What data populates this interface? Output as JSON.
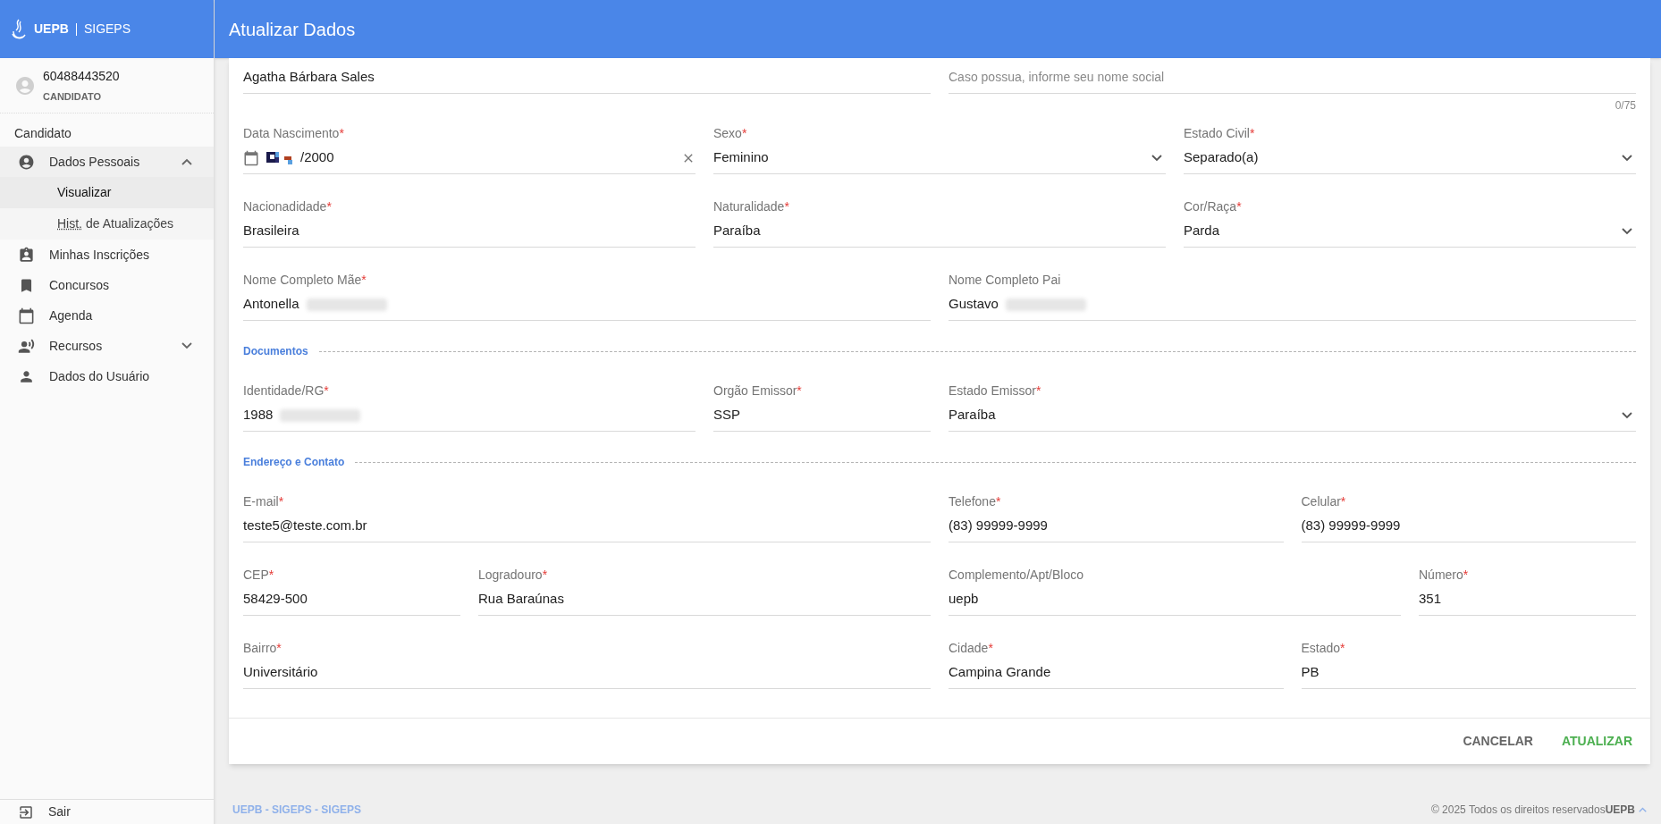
{
  "sidebar": {
    "brand": {
      "name": "UEPB",
      "suffix": "SIGEPS"
    },
    "user": {
      "id": "60488443520",
      "role": "CANDIDATO"
    },
    "section": "Candidato",
    "items": [
      {
        "label": "Dados Pessoais",
        "selected": false,
        "expanded": true,
        "children": [
          {
            "label": "Visualizar",
            "selected": true
          },
          {
            "abbr": "Hist.",
            "label": "de Atualizações",
            "selected": false
          }
        ]
      },
      {
        "label": "Minhas Inscrições",
        "selected": false
      },
      {
        "label": "Concursos",
        "selected": false
      },
      {
        "label": "Agenda",
        "selected": false
      },
      {
        "label": "Recursos",
        "selected": false,
        "expanded": false
      },
      {
        "label": "Dados do Usuário",
        "selected": false
      }
    ],
    "logout": "Sair"
  },
  "header": {
    "title": "Atualizar Dados"
  },
  "form": {
    "blocks": [
      {
        "kind": "fields",
        "fields": [
          {
            "kind": "text",
            "value": "Agatha Bárbara Sales"
          },
          {
            "kind": "text",
            "placeholder": "Caso possua, informe seu nome social",
            "counter": "0/75"
          }
        ]
      },
      {
        "kind": "fields",
        "fields": [
          {
            "kind": "date",
            "label": "Data Nascimento",
            "required_mark": "*",
            "value": "/2000",
            "pixelated": true
          },
          {
            "kind": "select",
            "label": "Sexo",
            "required_mark": "*",
            "value": "Feminino"
          },
          {
            "kind": "select",
            "label": "Estado Civil",
            "required_mark": "*",
            "value": "Separado(a)"
          }
        ]
      },
      {
        "kind": "fields",
        "fields": [
          {
            "kind": "text",
            "label": "Nacionadidade",
            "required_mark": "*",
            "value": "Brasileira"
          },
          {
            "kind": "text",
            "label": "Naturalidade",
            "required_mark": "*",
            "value": "Paraíba"
          },
          {
            "kind": "select",
            "label": "Cor/Raça",
            "required_mark": "*",
            "value": "Parda"
          }
        ]
      },
      {
        "kind": "fields",
        "fields": [
          {
            "kind": "text",
            "label": "Nome Completo Mãe",
            "required_mark": "*",
            "value": "Antonella",
            "blurred": true
          },
          {
            "kind": "text",
            "label": "Nome Completo Pai",
            "value": "Gustavo",
            "blurred": true
          }
        ]
      },
      {
        "kind": "section",
        "title": "Documentos"
      },
      {
        "kind": "fields",
        "fields": [
          {
            "kind": "text",
            "label": "Identidade/RG",
            "required_mark": "*",
            "value": "1988",
            "blurred": true
          },
          {
            "kind": "text",
            "label": "Orgão Emissor",
            "required_mark": "*",
            "value": "SSP"
          },
          {
            "kind": "select",
            "label": "Estado Emissor",
            "required_mark": "*",
            "value": "Paraíba"
          }
        ]
      },
      {
        "kind": "section",
        "title": "Endereço e Contato"
      },
      {
        "kind": "fields",
        "fields": [
          {
            "kind": "text",
            "label": "E-mail",
            "required_mark": "*",
            "value": "teste5@teste.com.br"
          },
          {
            "kind": "text",
            "label": "Telefone",
            "required_mark": "*",
            "value": "(83) 99999-9999"
          },
          {
            "kind": "text",
            "label": "Celular",
            "required_mark": "*",
            "value": "(83) 99999-9999"
          }
        ]
      },
      {
        "kind": "fields",
        "fields": [
          {
            "kind": "text",
            "label": "CEP",
            "required_mark": "*",
            "value": "58429-500"
          },
          {
            "kind": "text",
            "label": "Logradouro",
            "required_mark": "*",
            "value": "Rua Baraúnas"
          },
          {
            "kind": "text",
            "label": "Complemento/Apt/Bloco",
            "value": "uepb"
          },
          {
            "kind": "text",
            "label": "Número",
            "required_mark": "*",
            "value": "351"
          }
        ]
      },
      {
        "kind": "fields",
        "fields": [
          {
            "kind": "text",
            "label": "Bairro",
            "required_mark": "*",
            "value": "Universitário"
          },
          {
            "kind": "text",
            "label": "Cidade",
            "required_mark": "*",
            "value": "Campina Grande"
          },
          {
            "kind": "text",
            "label": "Estado",
            "required_mark": "*",
            "value": "PB"
          }
        ]
      }
    ]
  },
  "actions": [
    {
      "kind": "secondary",
      "label": "CANCELAR"
    },
    {
      "kind": "primary",
      "label": "ATUALIZAR"
    }
  ],
  "footer": {
    "left": "UEPB - SIGEPS - SIGEPS",
    "right": "© 2025 Todos os direitos reservados",
    "right_bold": "UEPB"
  }
}
